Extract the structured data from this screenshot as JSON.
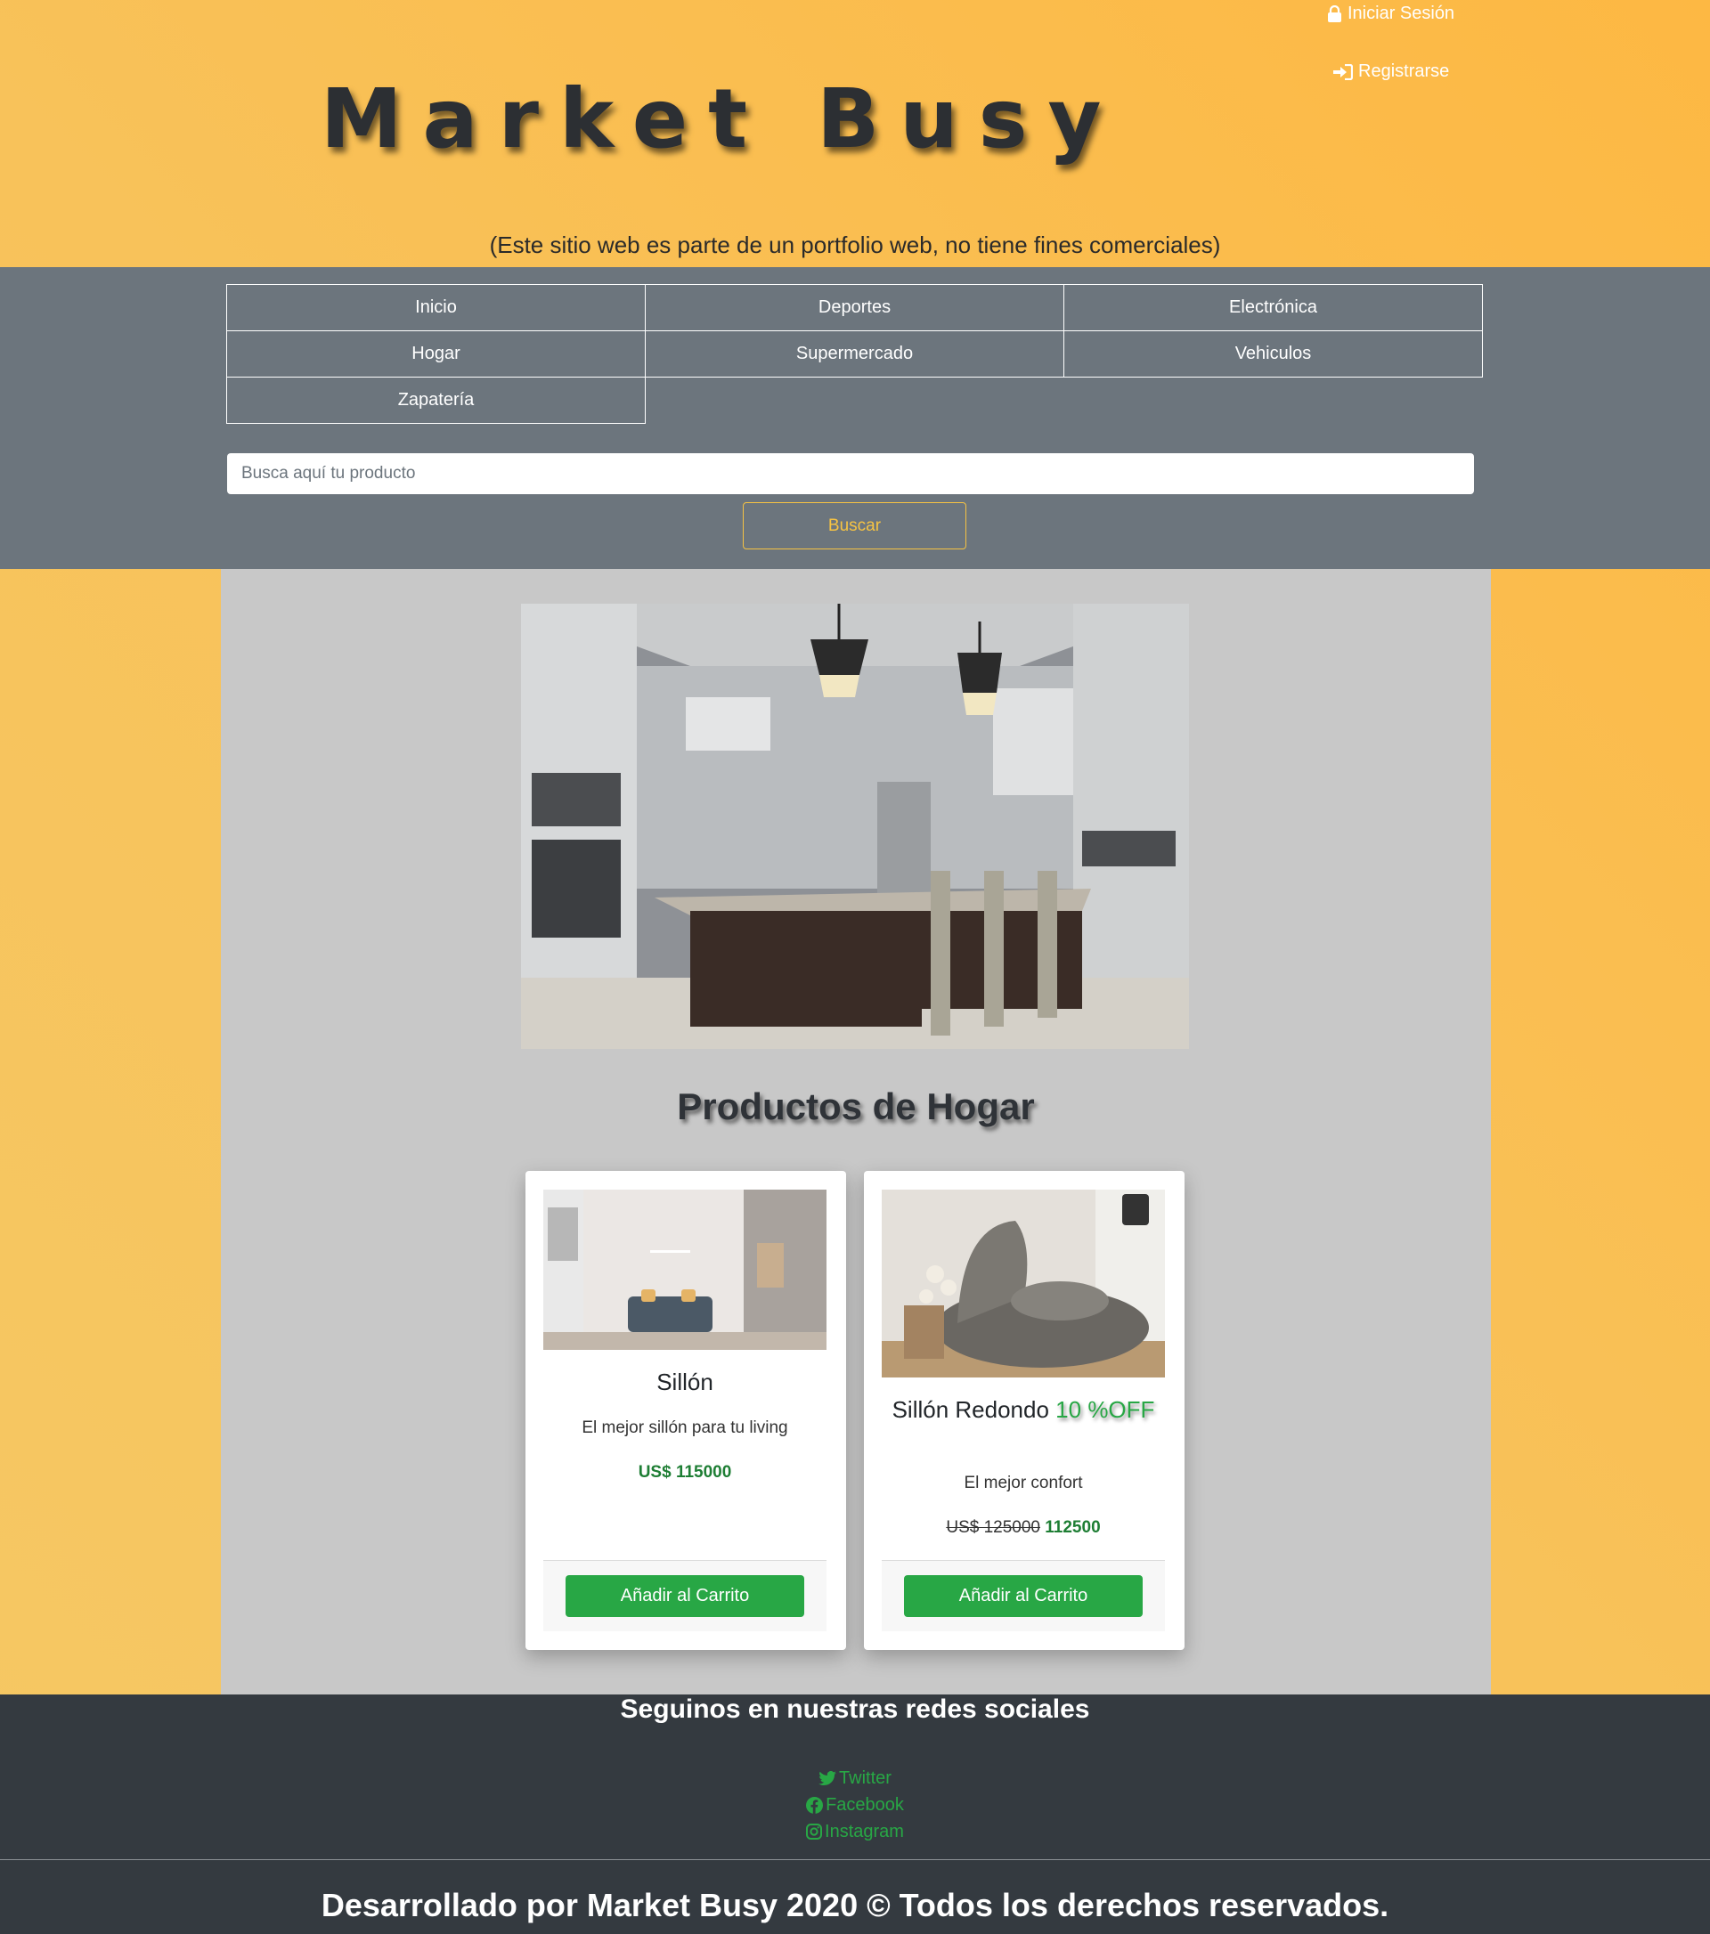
{
  "header": {
    "login_label": "Iniciar Sesión",
    "register_label": "Registrarse",
    "brand": "Market Busy",
    "disclaimer": "(Este sitio web es parte de un portfolio web, no tiene fines comerciales)"
  },
  "nav": {
    "items": [
      {
        "label": "Inicio"
      },
      {
        "label": "Deportes"
      },
      {
        "label": "Electrónica"
      },
      {
        "label": "Hogar"
      },
      {
        "label": "Supermercado"
      },
      {
        "label": "Vehiculos"
      },
      {
        "label": "Zapatería"
      }
    ]
  },
  "search": {
    "placeholder": "Busca aquí tu producto",
    "button_label": "Buscar"
  },
  "main": {
    "section_title": "Productos de Hogar",
    "products": [
      {
        "title": "Sillón",
        "description": "El mejor sillón para tu living",
        "price": "US$ 115000",
        "button_label": "Añadir al Carrito"
      },
      {
        "title": "Sillón Redondo",
        "discount": "10 %OFF",
        "description": "El mejor confort",
        "old_price": "US$ 125000",
        "price": "112500",
        "button_label": "Añadir al Carrito"
      }
    ]
  },
  "footer": {
    "social_title": "Seguinos en nuestras redes sociales",
    "links": [
      {
        "label": "Twitter",
        "icon": "twitter-icon"
      },
      {
        "label": "Facebook",
        "icon": "facebook-icon"
      },
      {
        "label": "Instagram",
        "icon": "instagram-icon"
      }
    ],
    "copyright": "Desarrollado por Market Busy 2020 © Todos los derechos reservados."
  },
  "colors": {
    "accent_orange": "#fdb843",
    "nav_gray": "#6c757d",
    "footer_dark": "#343a40",
    "success_green": "#28a745",
    "search_button_yellow": "#f6c343"
  }
}
